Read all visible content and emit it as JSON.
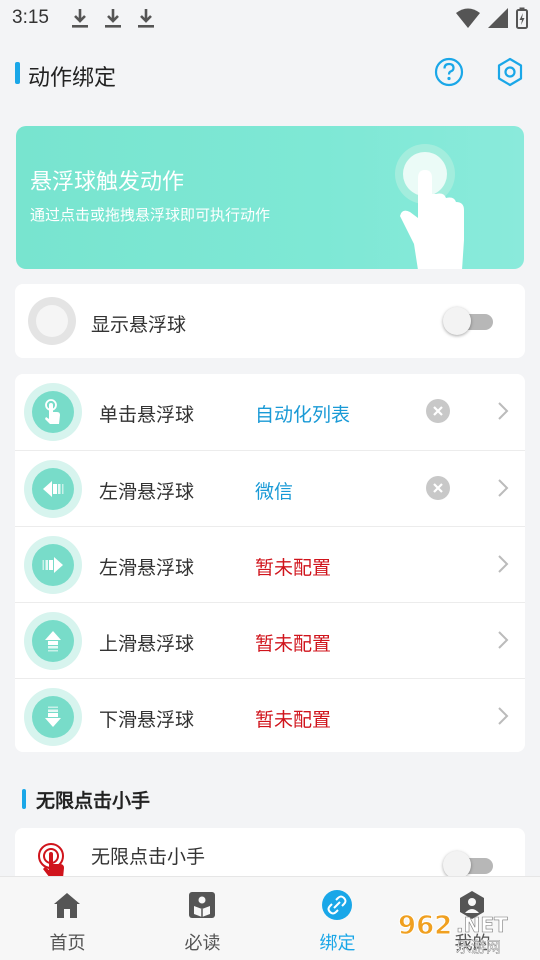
{
  "status_bar": {
    "time": "3:15"
  },
  "header": {
    "title": "动作绑定"
  },
  "banner": {
    "title": "悬浮球触发动作",
    "subtitle": "通过点击或拖拽悬浮球即可执行动作"
  },
  "show_ball": {
    "label": "显示悬浮球",
    "enabled": false
  },
  "actions": [
    {
      "label": "单击悬浮球",
      "value": "自动化列表",
      "value_color": "#1a9ad6",
      "clearable": true,
      "icon": "tap-hand-icon"
    },
    {
      "label": "左滑悬浮球",
      "value": "微信",
      "value_color": "#1a9ad6",
      "clearable": true,
      "icon": "swipe-left-icon"
    },
    {
      "label": "左滑悬浮球",
      "value": "暂未配置",
      "value_color": "#d0141c",
      "clearable": false,
      "icon": "swipe-right-icon"
    },
    {
      "label": "上滑悬浮球",
      "value": "暂未配置",
      "value_color": "#d0141c",
      "clearable": false,
      "icon": "swipe-up-icon"
    },
    {
      "label": "下滑悬浮球",
      "value": "暂未配置",
      "value_color": "#d0141c",
      "clearable": false,
      "icon": "swipe-down-icon"
    }
  ],
  "section": {
    "title": "无限点击小手"
  },
  "clicker": {
    "label": "无限点击小手",
    "enabled": false
  },
  "bottom_nav": [
    {
      "label": "首页",
      "icon": "home-icon",
      "active": false
    },
    {
      "label": "必读",
      "icon": "book-icon",
      "active": false
    },
    {
      "label": "绑定",
      "icon": "link-icon",
      "active": true
    },
    {
      "label": "我的",
      "icon": "user-icon",
      "active": false
    }
  ],
  "watermark": {
    "text": "962.NET",
    "sub": "乐游网"
  },
  "colors": {
    "accent": "#1aa7e8",
    "teal": "#78dcc9",
    "unset": "#d0141c"
  }
}
